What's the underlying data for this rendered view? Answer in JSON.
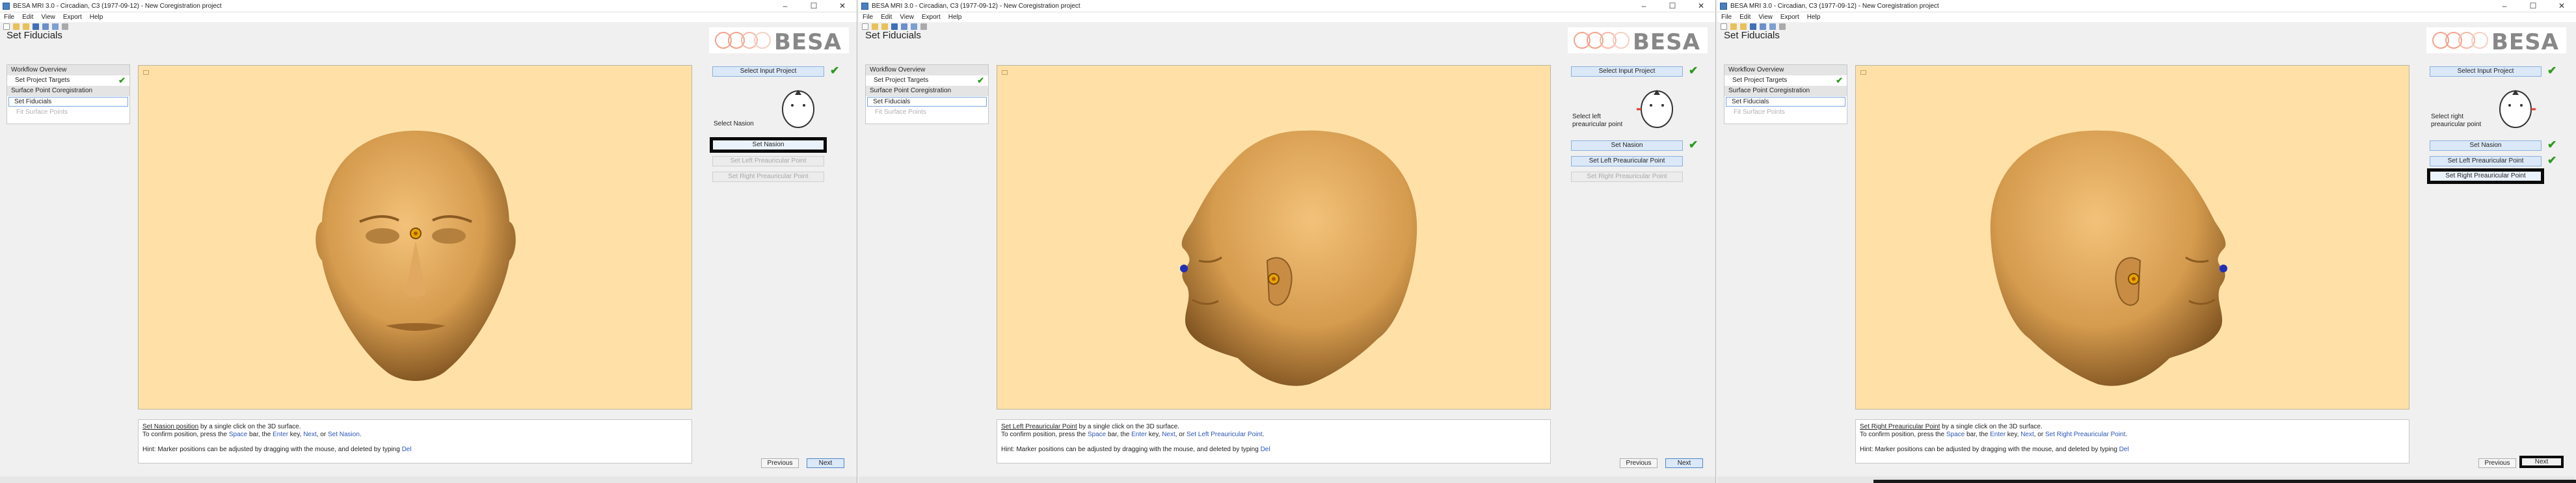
{
  "windows": [
    {
      "title": "BESA MRI 3.0 - Circadian, C3 (1977-09-12) - New Coregistration project",
      "menu": [
        "File",
        "Edit",
        "View",
        "Export",
        "Help"
      ],
      "page_title": "Set Fiducials",
      "workflow": {
        "header": "Workflow Overview",
        "item1": "Set Project Targets",
        "section": "Surface Point Coregistration",
        "active": "Set Fiducials",
        "disabled": "Fit Surface Points"
      },
      "right": {
        "select_input": "Select Input Project",
        "prompt": "Select Nasion",
        "btn_nasion": "Set Nasion",
        "btn_left": "Set Left Preauricular Point",
        "btn_right": "Set Right Preauricular Point"
      },
      "instruction": {
        "target": "Set Nasion position",
        "line1_rest": " by a single click on the 3D surface.",
        "confirm": "To confirm position, press the ",
        "space": "Space",
        "bar": " bar, the ",
        "enter": "Enter",
        "key": " key, ",
        "next": "Next",
        "or": ", or ",
        "action": "Set Nasion",
        "end": ".",
        "hint": "Hint: Marker positions can be adjusted by dragging with the mouse, and deleted by typing ",
        "del": "Del"
      },
      "nav": {
        "previous": "Previous",
        "next": "Next"
      }
    },
    {
      "title": "BESA MRI 3.0 - Circadian, C3 (1977-09-12) - New Coregistration project",
      "menu": [
        "File",
        "Edit",
        "View",
        "Export",
        "Help"
      ],
      "page_title": "Set Fiducials",
      "workflow": {
        "header": "Workflow Overview",
        "item1": "Set Project Targets",
        "section": "Surface Point Coregistration",
        "active": "Set Fiducials",
        "disabled": "Fit Surface Points"
      },
      "right": {
        "select_input": "Select Input Project",
        "prompt": "Select left preauricular point",
        "btn_nasion": "Set Nasion",
        "btn_left": "Set Left Preauricular Point",
        "btn_right": "Set Right Preauricular Point"
      },
      "instruction": {
        "target": "Set Left Preauricular Point",
        "line1_rest": " by a single click on the 3D surface.",
        "confirm": "To confirm position, press the ",
        "space": "Space",
        "bar": " bar, the ",
        "enter": "Enter",
        "key": " key, ",
        "next": "Next",
        "or": ", or ",
        "action": "Set Left Preauricular Point",
        "end": ".",
        "hint": "Hint: Marker positions can be adjusted by dragging with the mouse, and deleted by typing ",
        "del": "Del"
      },
      "nav": {
        "previous": "Previous",
        "next": "Next"
      }
    },
    {
      "title": "BESA MRI 3.0 - Circadian, C3 (1977-09-12) - New Coregistration project",
      "menu": [
        "File",
        "Edit",
        "View",
        "Export",
        "Help"
      ],
      "page_title": "Set Fiducials",
      "workflow": {
        "header": "Workflow Overview",
        "item1": "Set Project Targets",
        "section": "Surface Point Coregistration",
        "active": "Set Fiducials",
        "disabled": "Fit Surface Points"
      },
      "right": {
        "select_input": "Select Input Project",
        "prompt": "Select right preauricular point",
        "btn_nasion": "Set Nasion",
        "btn_left": "Set Left Preauricular Point",
        "btn_right": "Set Right Preauricular Point"
      },
      "instruction": {
        "target": "Set Right Preauricular Point",
        "line1_rest": " by a single click on the 3D surface.",
        "confirm": "To confirm position, press the ",
        "space": "Space",
        "bar": " bar, the ",
        "enter": "Enter",
        "key": " key, ",
        "next": "Next",
        "or": ", or ",
        "action": "Set Right Preauricular Point",
        "end": ".",
        "hint": "Hint: Marker positions can be adjusted by dragging with the mouse, and deleted by typing ",
        "del": "Del"
      },
      "nav": {
        "previous": "Previous",
        "next": "Next"
      }
    }
  ],
  "brand": {
    "logo_text": "BESA",
    "accent": "#2c9a1f",
    "viewport_bg": "#ffe1a8",
    "skin": "#d9a45a"
  },
  "window_controls": {
    "minimize": "–",
    "maximize": "☐",
    "close": "✕"
  }
}
